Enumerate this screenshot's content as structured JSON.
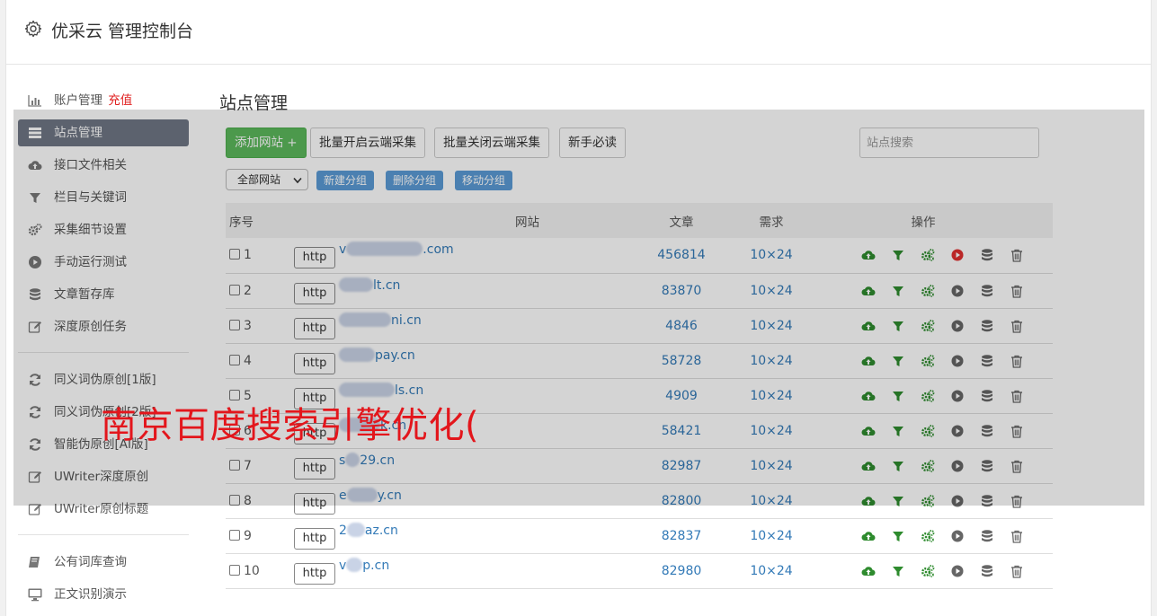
{
  "header": {
    "title": "优采云 管理控制台",
    "icon": "gear-icon"
  },
  "sidebar": {
    "group1": [
      {
        "label": "账户管理",
        "extra": "充值",
        "icon": "bar-chart-icon",
        "active": false
      },
      {
        "label": "站点管理",
        "icon": "list-icon",
        "active": true
      },
      {
        "label": "接口文件相关",
        "icon": "cloud-upload-icon",
        "active": false
      },
      {
        "label": "栏目与关键词",
        "icon": "filter-icon",
        "active": false
      },
      {
        "label": "采集细节设置",
        "icon": "gears-icon",
        "active": false
      },
      {
        "label": "手动运行测试",
        "icon": "play-circle-icon",
        "active": false
      },
      {
        "label": "文章暂存库",
        "icon": "database-icon",
        "active": false
      },
      {
        "label": "深度原创任务",
        "icon": "edit-icon",
        "active": false
      }
    ],
    "group2": [
      {
        "label": "同义词伪原创[1版]",
        "icon": "refresh-icon"
      },
      {
        "label": "同义词伪原创[2版]",
        "icon": "refresh-icon"
      },
      {
        "label": "智能伪原创[AI版]",
        "icon": "refresh-icon"
      },
      {
        "label": "UWriter深度原创",
        "icon": "edit-icon"
      },
      {
        "label": "UWriter原创标题",
        "icon": "edit-icon"
      }
    ],
    "group3": [
      {
        "label": "公有词库查询",
        "icon": "book-icon"
      },
      {
        "label": "正文识别演示",
        "icon": "monitor-icon"
      }
    ]
  },
  "main": {
    "title": "站点管理",
    "toolbar": {
      "add_site": "添加网站 +",
      "batch_enable": "批量开启云端采集",
      "batch_disable": "批量关闭云端采集",
      "newbie": "新手必读",
      "search_placeholder": "站点搜索"
    },
    "filter": {
      "selected": "全部网站",
      "new_group": "新建分组",
      "delete_group": "删除分组",
      "move_group": "移动分组"
    },
    "table": {
      "headers": {
        "no": "序号",
        "site": "网站",
        "articles": "文章",
        "demand": "需求",
        "actions": "操作"
      },
      "rows": [
        {
          "no": "1",
          "scheme": "http",
          "prefix": "v",
          "suffix": ".com",
          "articles": "456814",
          "demand": "10×24",
          "play_active": true
        },
        {
          "no": "2",
          "scheme": "http",
          "prefix": "",
          "suffix": "lt.cn",
          "articles": "83870",
          "demand": "10×24",
          "play_active": false
        },
        {
          "no": "3",
          "scheme": "http",
          "prefix": "",
          "suffix": "ni.cn",
          "articles": "4846",
          "demand": "10×24",
          "play_active": false
        },
        {
          "no": "4",
          "scheme": "http",
          "prefix": "",
          "suffix": "pay.cn",
          "articles": "58728",
          "demand": "10×24",
          "play_active": false
        },
        {
          "no": "5",
          "scheme": "http",
          "prefix": "",
          "suffix": "ls.cn",
          "articles": "4909",
          "demand": "10×24",
          "play_active": false
        },
        {
          "no": "6",
          "scheme": "http",
          "prefix": "",
          "suffix": "k.cn",
          "articles": "58421",
          "demand": "10×24",
          "play_active": false
        },
        {
          "no": "7",
          "scheme": "http",
          "prefix": "s",
          "suffix": "29.cn",
          "articles": "82987",
          "demand": "10×24",
          "play_active": false
        },
        {
          "no": "8",
          "scheme": "http",
          "prefix": "e",
          "suffix": "y.cn",
          "articles": "82800",
          "demand": "10×24",
          "play_active": false
        },
        {
          "no": "9",
          "scheme": "http",
          "prefix": "2",
          "suffix": "az.cn",
          "articles": "82837",
          "demand": "10×24",
          "play_active": false
        },
        {
          "no": "10",
          "scheme": "http",
          "prefix": "v",
          "suffix": "p.cn",
          "articles": "82980",
          "demand": "10×24",
          "play_active": false
        }
      ]
    }
  },
  "watermark": "南京百度搜索引擎优化(",
  "colors": {
    "green": "#5cb85c",
    "blue_btn": "#5b9bd5",
    "link": "#337ab7",
    "recharge": "#e02020",
    "sidebar_active": "#6f7685",
    "icon_green": "#2e8b2e",
    "play_red": "#e03030"
  }
}
